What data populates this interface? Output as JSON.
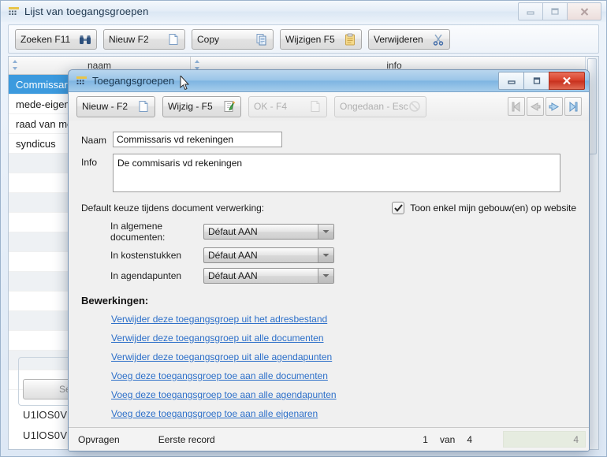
{
  "main_window": {
    "title": "Lijst van toegangsgroepen",
    "ghost_title": "",
    "icon": "grid-icon",
    "window_buttons": {
      "minimize": "minimize-icon",
      "maximize": "maximize-icon",
      "close": "close-icon"
    },
    "toolbar": [
      {
        "label": "Zoeken F11",
        "icon": "binoculars-icon"
      },
      {
        "label": "Nieuw F2",
        "icon": "new-document-icon"
      },
      {
        "label": "Copy",
        "icon": "copy-icon"
      },
      {
        "label": "Wijzigen F5",
        "icon": "clipboard-icon"
      },
      {
        "label": "Verwijderen",
        "icon": "scissors-icon"
      }
    ],
    "grid": {
      "columns": [
        "naam",
        "info"
      ],
      "rows": [
        {
          "naam": "Commissaris vd rekeningen",
          "info": "",
          "selected": true
        },
        {
          "naam": "mede-eigenaar",
          "info": "",
          "selected": false
        },
        {
          "naam": "raad van mede-eigendom",
          "info": "",
          "selected": false
        },
        {
          "naam": "syndicus",
          "info": "",
          "selected": false
        }
      ]
    },
    "select_button": "Selec",
    "key_rows": [
      "U1lOS0V",
      "U1lOS0V"
    ]
  },
  "dialog": {
    "title": "Toegangsgroepen",
    "icon": "grid-icon",
    "window_buttons": {
      "minimize": "minimize-icon",
      "maximize": "maximize-icon",
      "close": "close-icon"
    },
    "toolbar": [
      {
        "label": "Nieuw - F2",
        "icon": "new-document-icon",
        "disabled": false
      },
      {
        "label": "Wijzig - F5",
        "icon": "edit-icon",
        "disabled": false
      },
      {
        "label": "OK - F4",
        "icon": "ok-icon",
        "disabled": true
      },
      {
        "label": "Ongedaan - Esc",
        "icon": "undo-icon",
        "disabled": true
      }
    ],
    "nav": [
      {
        "icon": "first-record-icon",
        "disabled": true
      },
      {
        "icon": "previous-record-icon",
        "disabled": true
      },
      {
        "icon": "next-record-icon",
        "disabled": false
      },
      {
        "icon": "last-record-icon",
        "disabled": false
      }
    ],
    "form": {
      "naam_label": "Naam",
      "naam_value": "Commissaris vd rekeningen",
      "info_label": "Info",
      "info_value": "De commisaris vd rekeningen"
    },
    "defaults": {
      "section_label": "Default keuze tijdens document verwerking:",
      "checkbox_label": "Toon enkel mijn gebouw(en) op website",
      "checkbox_checked": true,
      "rows": [
        {
          "label": "In algemene documenten:",
          "value": "Défaut AAN"
        },
        {
          "label": "In kostenstukken",
          "value": "Défaut AAN"
        },
        {
          "label": "In agendapunten",
          "value": "Défaut AAN"
        }
      ]
    },
    "operations": {
      "title": "Bewerkingen:",
      "links": [
        "Verwijder deze toegangsgroep uit het adresbestand",
        "Verwijder deze toegangsgroep uit alle documenten",
        "Verwijder deze toegangsgroep uit alle agendapunten",
        "Voeg deze toegangsgroep toe aan alle documenten",
        "Voeg deze toegangsgroep toe aan alle agendapunten",
        "Voeg deze toegangsgroep toe aan alle eigenaren"
      ]
    },
    "status": {
      "action": "Opvragen",
      "record": "Eerste record",
      "position": "1",
      "of_label": "van",
      "total": "4",
      "right_count": "4"
    }
  },
  "colors": {
    "accent_blue": "#3c9ade",
    "link_blue": "#2c6fc9",
    "close_red": "#d8402a",
    "dialog_title_blue": "#9cc6e8"
  }
}
